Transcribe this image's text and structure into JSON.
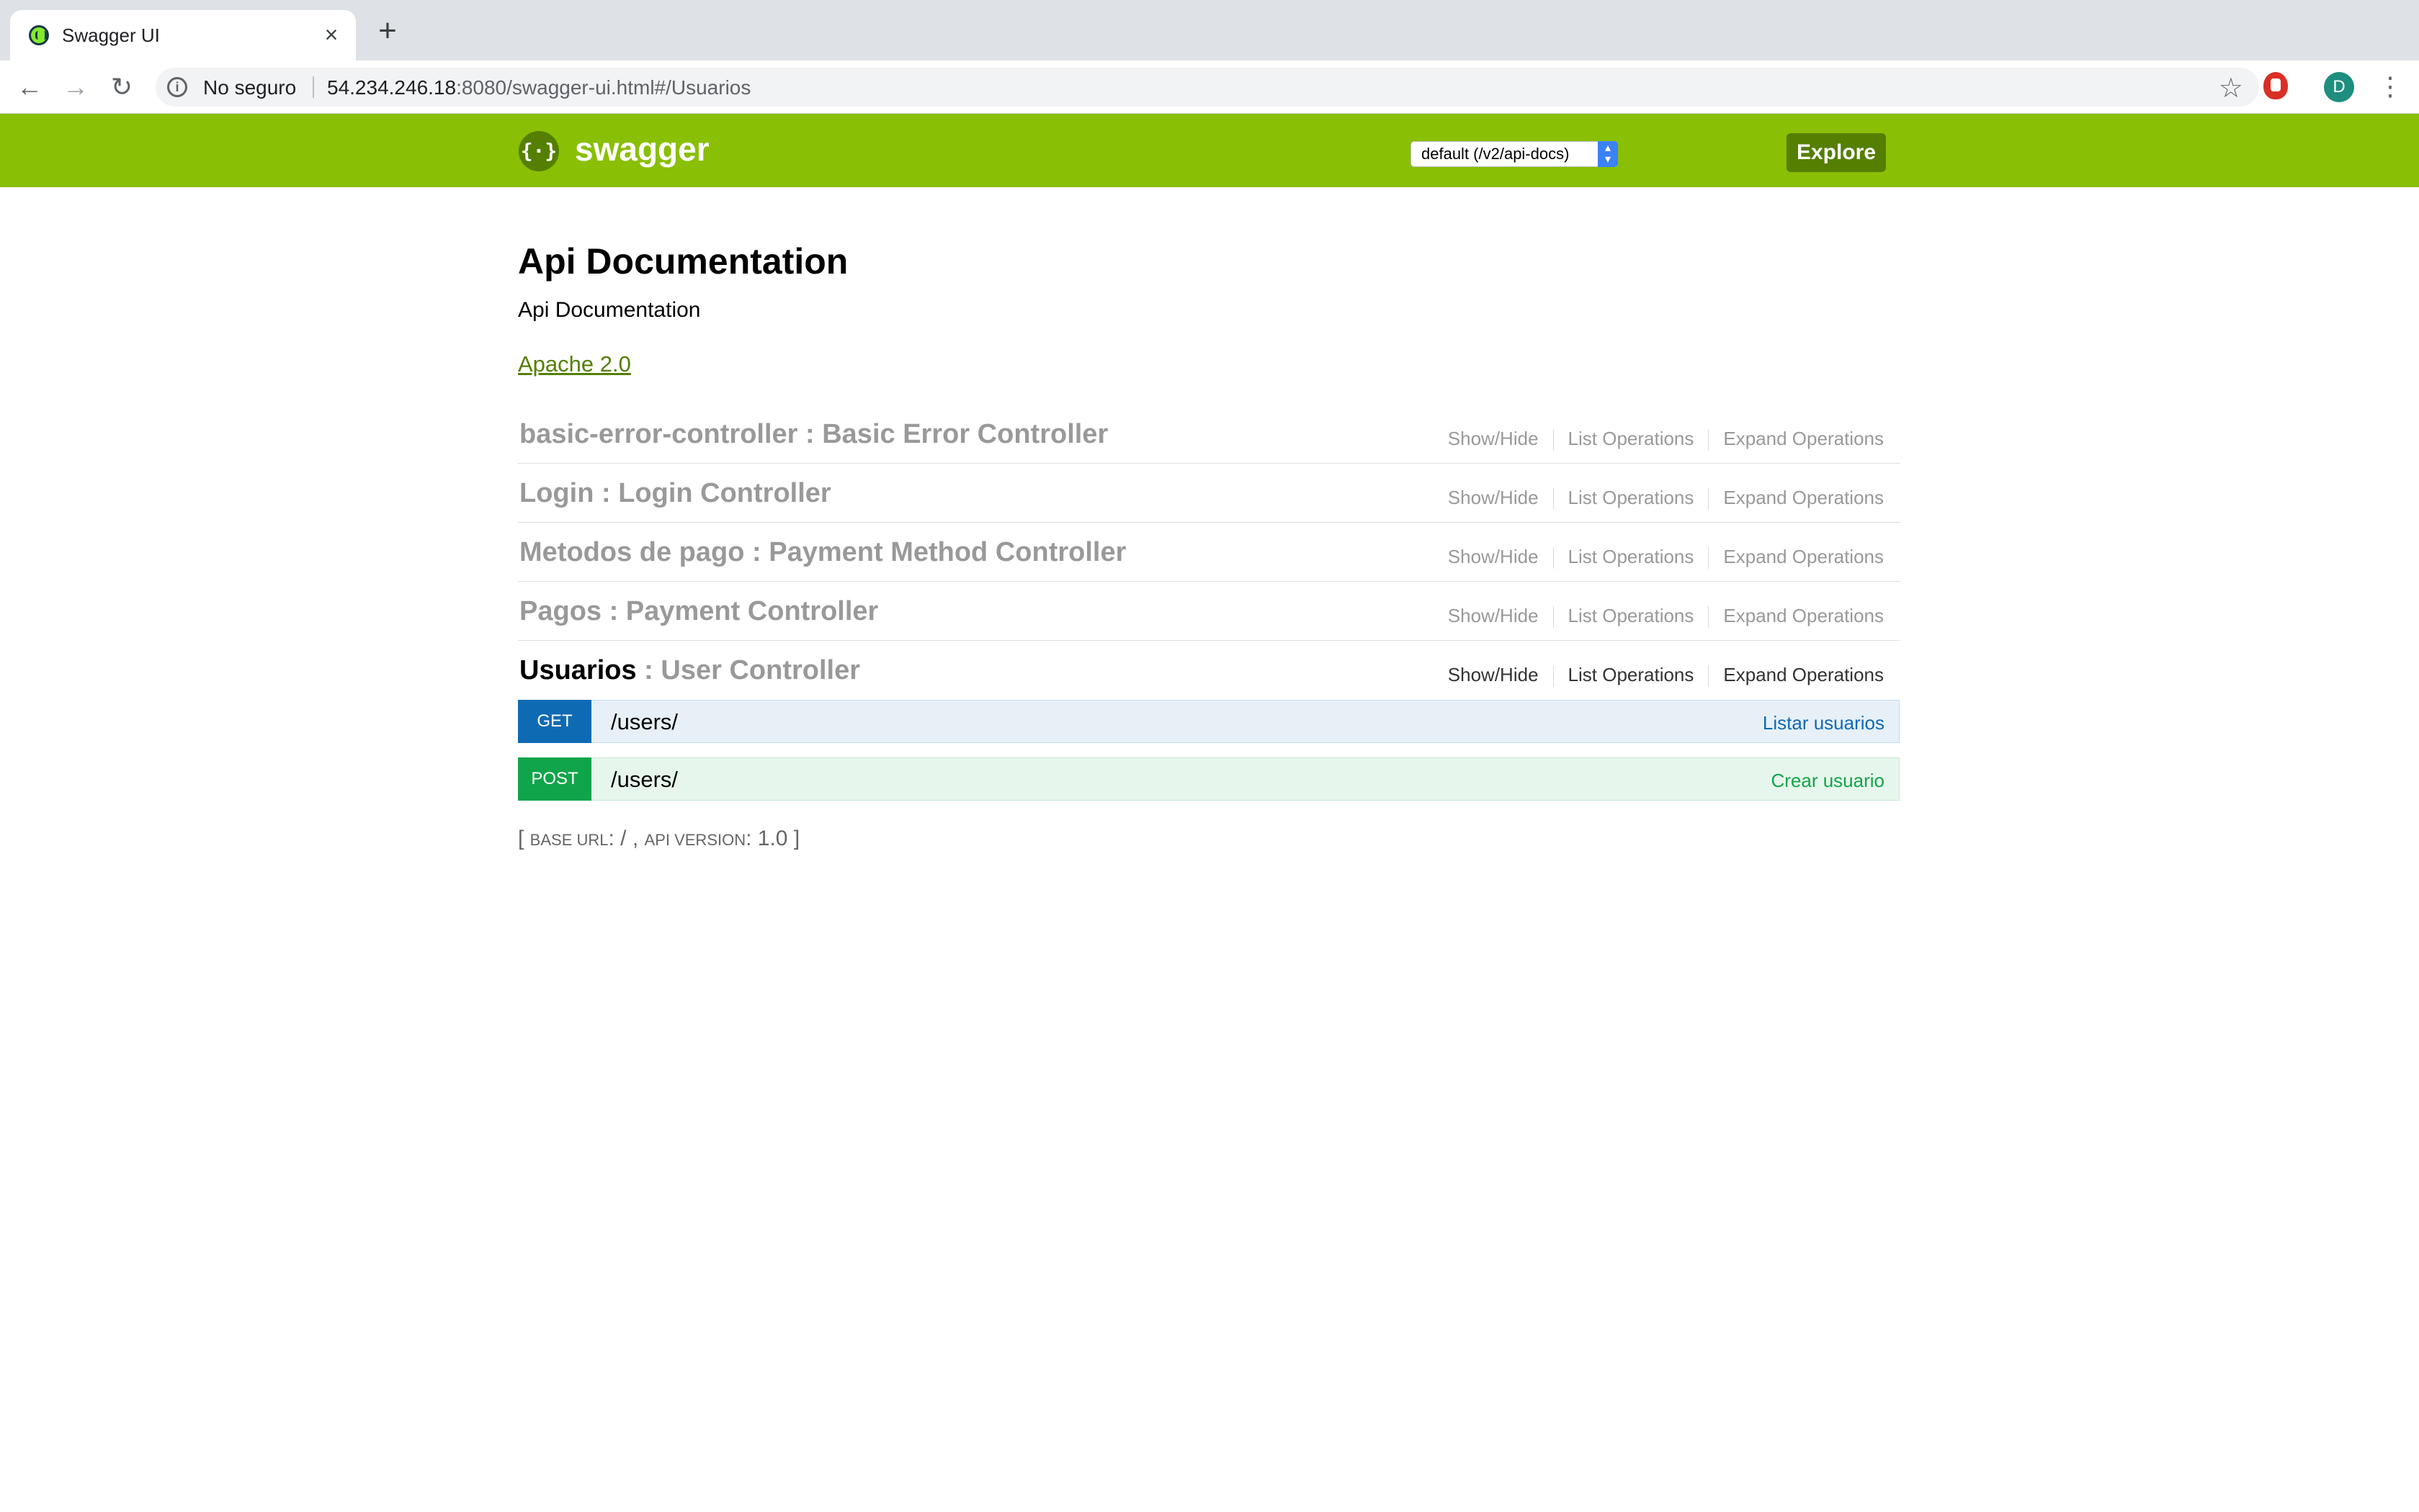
{
  "browser": {
    "tab_title": "Swagger UI",
    "security_label": "No seguro",
    "url_host": "54.234.246.18",
    "url_rest": ":8080/swagger-ui.html#/Usuarios",
    "avatar_initial": "D"
  },
  "header": {
    "logo_text": "swagger",
    "spec_select_value": "default (/v2/api-docs)",
    "explore_label": "Explore"
  },
  "info": {
    "title": "Api Documentation",
    "description": "Api Documentation",
    "license": "Apache 2.0"
  },
  "operations_labels": {
    "show_hide": "Show/Hide",
    "list": "List Operations",
    "expand": "Expand Operations"
  },
  "resources": [
    {
      "name": "basic-error-controller",
      "separator": " : ",
      "description": "Basic Error Controller"
    },
    {
      "name": "Login",
      "separator": " : ",
      "description": "Login Controller"
    },
    {
      "name": "Metodos de pago",
      "separator": " : ",
      "description": "Payment Method Controller"
    },
    {
      "name": "Pagos",
      "separator": " : ",
      "description": "Payment Controller"
    },
    {
      "name": "Usuarios",
      "separator": " : ",
      "description": "User Controller"
    }
  ],
  "endpoints": [
    {
      "method": "GET",
      "path": "/users/",
      "summary": "Listar usuarios"
    },
    {
      "method": "POST",
      "path": "/users/",
      "summary": "Crear usuario"
    }
  ],
  "footer": {
    "open": "[ ",
    "base_url_label": "base url",
    "base_url_value": ": / , ",
    "api_version_label": "api version",
    "api_version_value": ": 1.0 ]"
  }
}
